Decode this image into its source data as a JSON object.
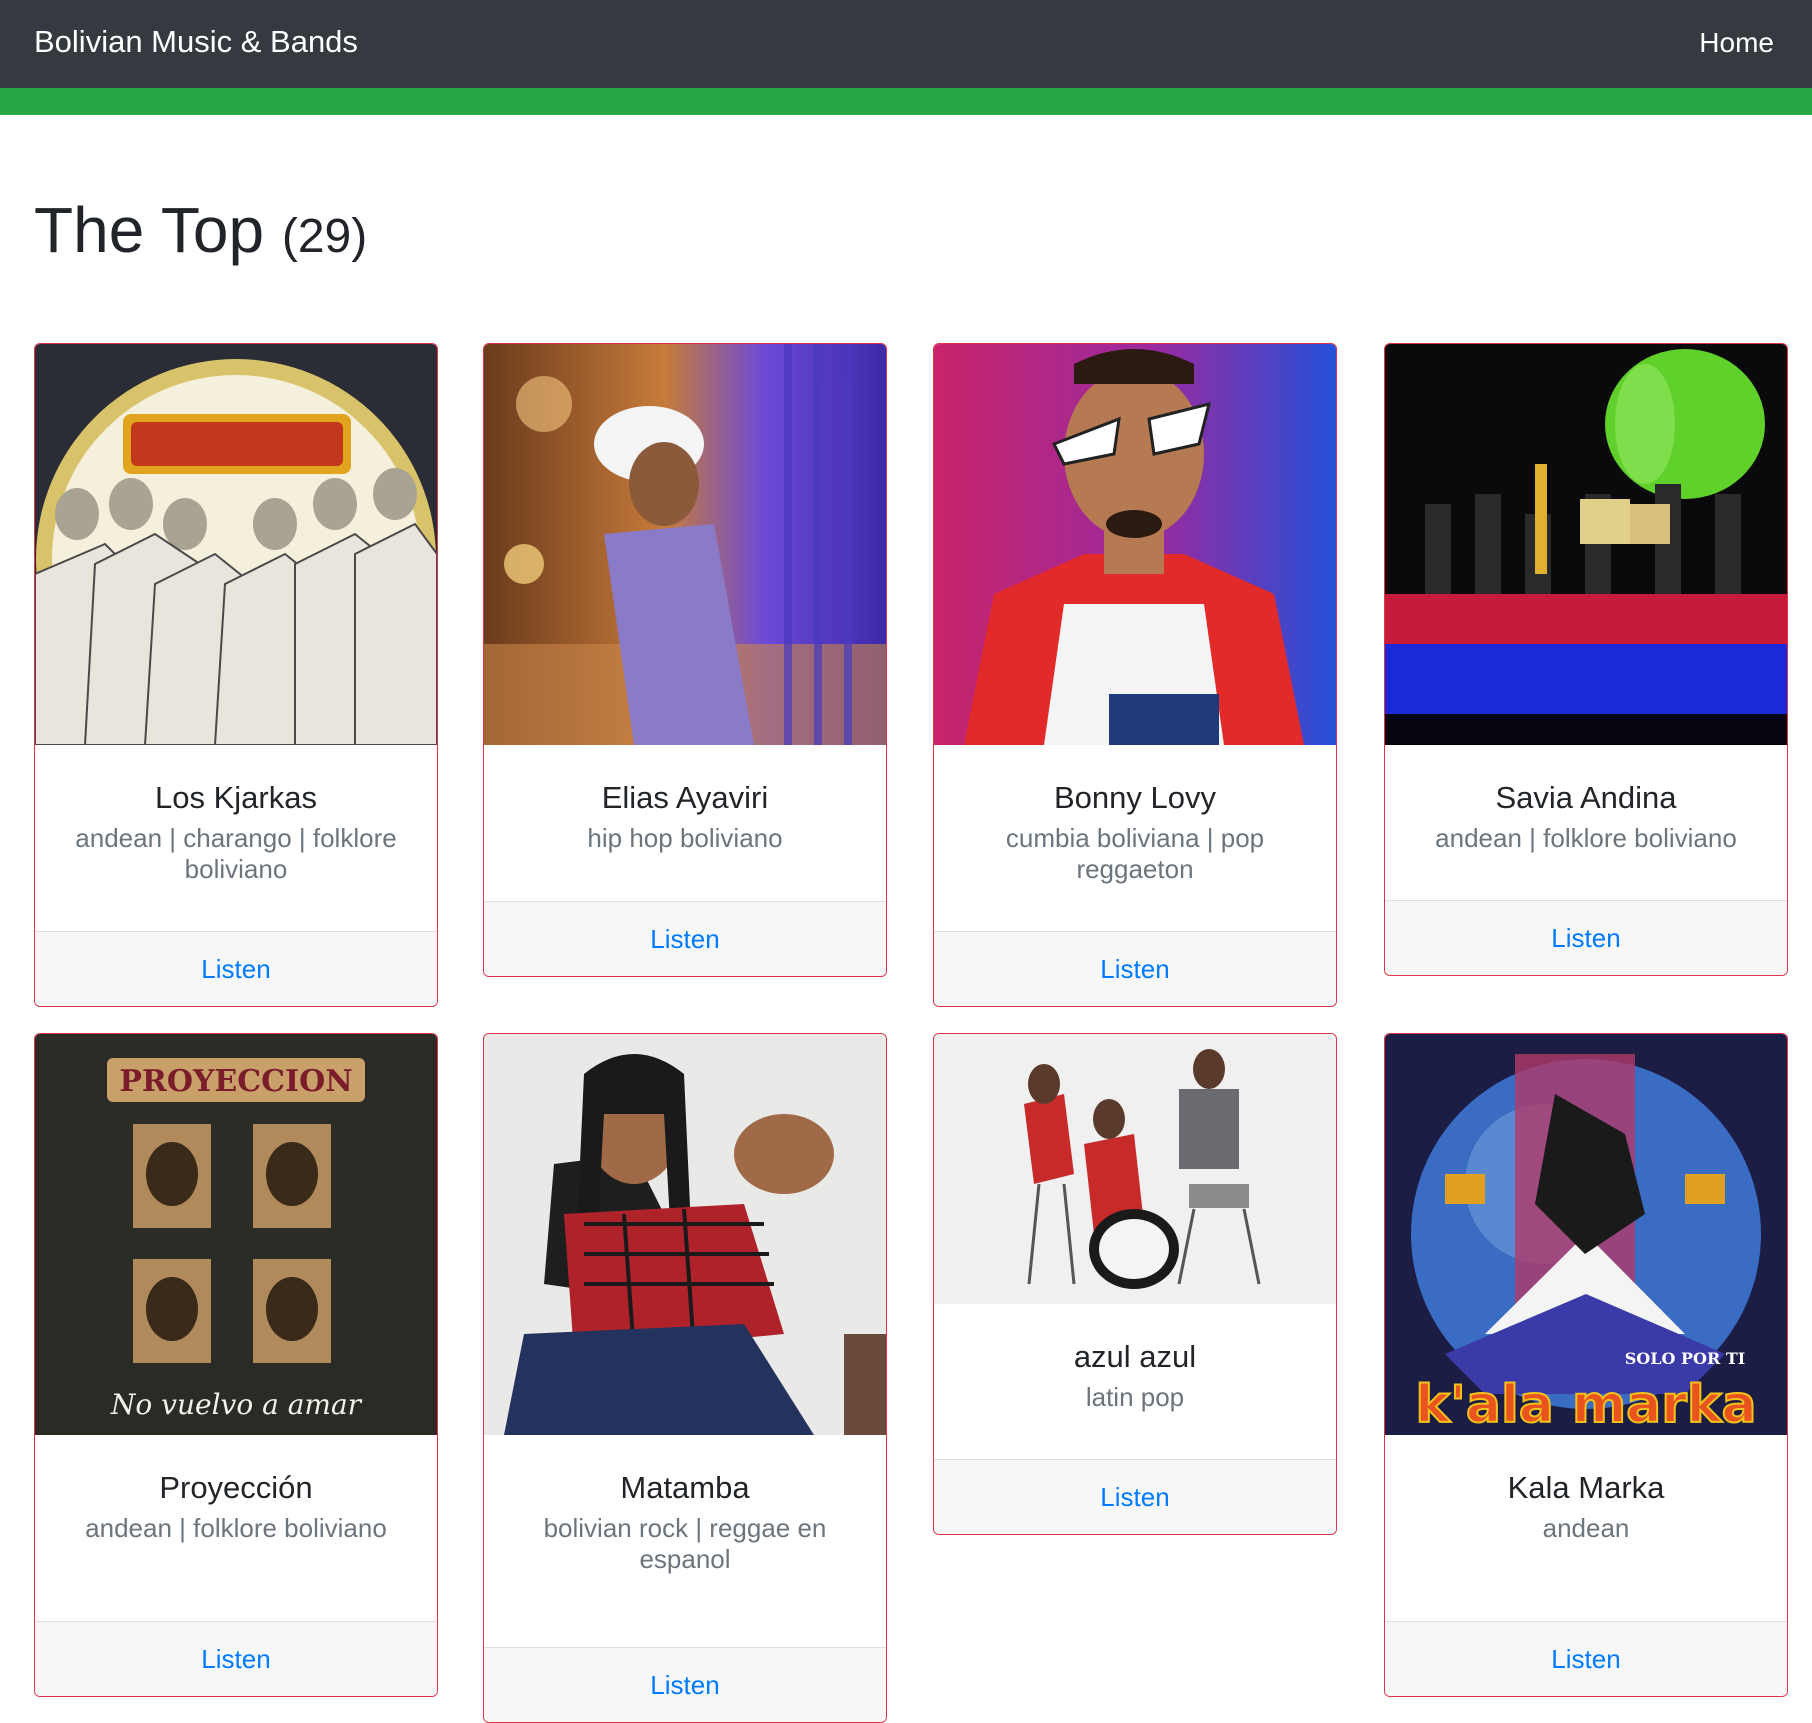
{
  "navbar": {
    "brand": "Bolivian Music & Bands",
    "home": "Home"
  },
  "heading": {
    "title": "The Top",
    "count": "(29)"
  },
  "cards": [
    {
      "name": "Los Kjarkas",
      "genres": "andean | charango | folklore boliviano",
      "listen": "Listen",
      "image": "band-photo"
    },
    {
      "name": "Elias Ayaviri",
      "genres": "hip hop boliviano",
      "listen": "Listen",
      "image": "artist-photo"
    },
    {
      "name": "Bonny Lovy",
      "genres": "cumbia boliviana | pop reggaeton",
      "listen": "Listen",
      "image": "artist-photo"
    },
    {
      "name": "Savia Andina",
      "genres": "andean | folklore boliviano",
      "listen": "Listen",
      "image": "concert-photo"
    },
    {
      "name": "Proyección",
      "genres": "andean | folklore boliviano",
      "listen": "Listen",
      "image": "album-cover",
      "cover_title": "PROYECCION",
      "cover_subtitle": "No vuelvo a amar"
    },
    {
      "name": "Matamba",
      "genres": "bolivian rock | reggae en espanol",
      "listen": "Listen",
      "image": "artist-photo"
    },
    {
      "name": "azul azul",
      "genres": "latin pop",
      "listen": "Listen",
      "image": "band-photo"
    },
    {
      "name": "Kala Marka",
      "genres": "andean",
      "listen": "Listen",
      "image": "album-cover",
      "cover_title": "k'ala marka",
      "cover_subtitle": "SOLO POR TI"
    }
  ],
  "colors": {
    "navbar": "#343a40",
    "accent_bar": "#28a745",
    "card_border": "#dc3545",
    "link": "#007bff",
    "muted": "#6c757d"
  }
}
